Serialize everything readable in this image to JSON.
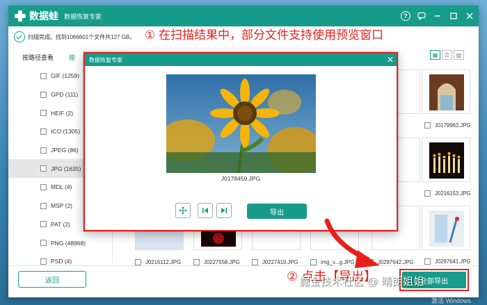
{
  "app": {
    "brand": "数据蛙",
    "subtitle": "数据恢复专家",
    "colors": {
      "accent": "#179b8a",
      "annotation": "#e8201c"
    }
  },
  "status": {
    "text": "扫描完成。找到1066601个文件共127 GB。"
  },
  "annotation_1": "① 在扫描结果中，部分文件支持使用预览窗口",
  "annotation_2": "② 点击【导出】",
  "tabs": [
    {
      "label": "按路径查看"
    },
    {
      "label": "按"
    }
  ],
  "file_types": [
    {
      "label": "GIF (1259)"
    },
    {
      "label": "GPD (111)"
    },
    {
      "label": "HEIF (2)"
    },
    {
      "label": "ICO (1305)"
    },
    {
      "label": "JPEG (86)"
    },
    {
      "label": "JPG (1635)"
    },
    {
      "label": "MDL (4)"
    },
    {
      "label": "MSP (2)"
    },
    {
      "label": "PAT (2)"
    },
    {
      "label": "PNG (48968)"
    },
    {
      "label": "PSD (4)"
    }
  ],
  "grid": {
    "captions_right": [
      {
        "label": "J0179963.JPG"
      },
      {
        "label": "J0216153.JPG"
      },
      {
        "label": "J0287641.JPG"
      }
    ],
    "captions_bottom": [
      {
        "label": "J0216112.JPG"
      },
      {
        "label": "J0227558.JPG"
      },
      {
        "label": "J0227419.JPG"
      },
      {
        "label": "img_v...g.JPG"
      },
      {
        "label": "J0287642.JPG"
      }
    ]
  },
  "preview": {
    "title": "数据恢复专家",
    "close_icon": "close-icon",
    "filename": "J0178459.JPG",
    "export_label": "导出"
  },
  "footer": {
    "back_label": "返回",
    "export_all_label": "全部导出"
  },
  "watermark": "掘金技术社区 @ 晴朗姐姐",
  "windows_notice": "激活 Windows"
}
